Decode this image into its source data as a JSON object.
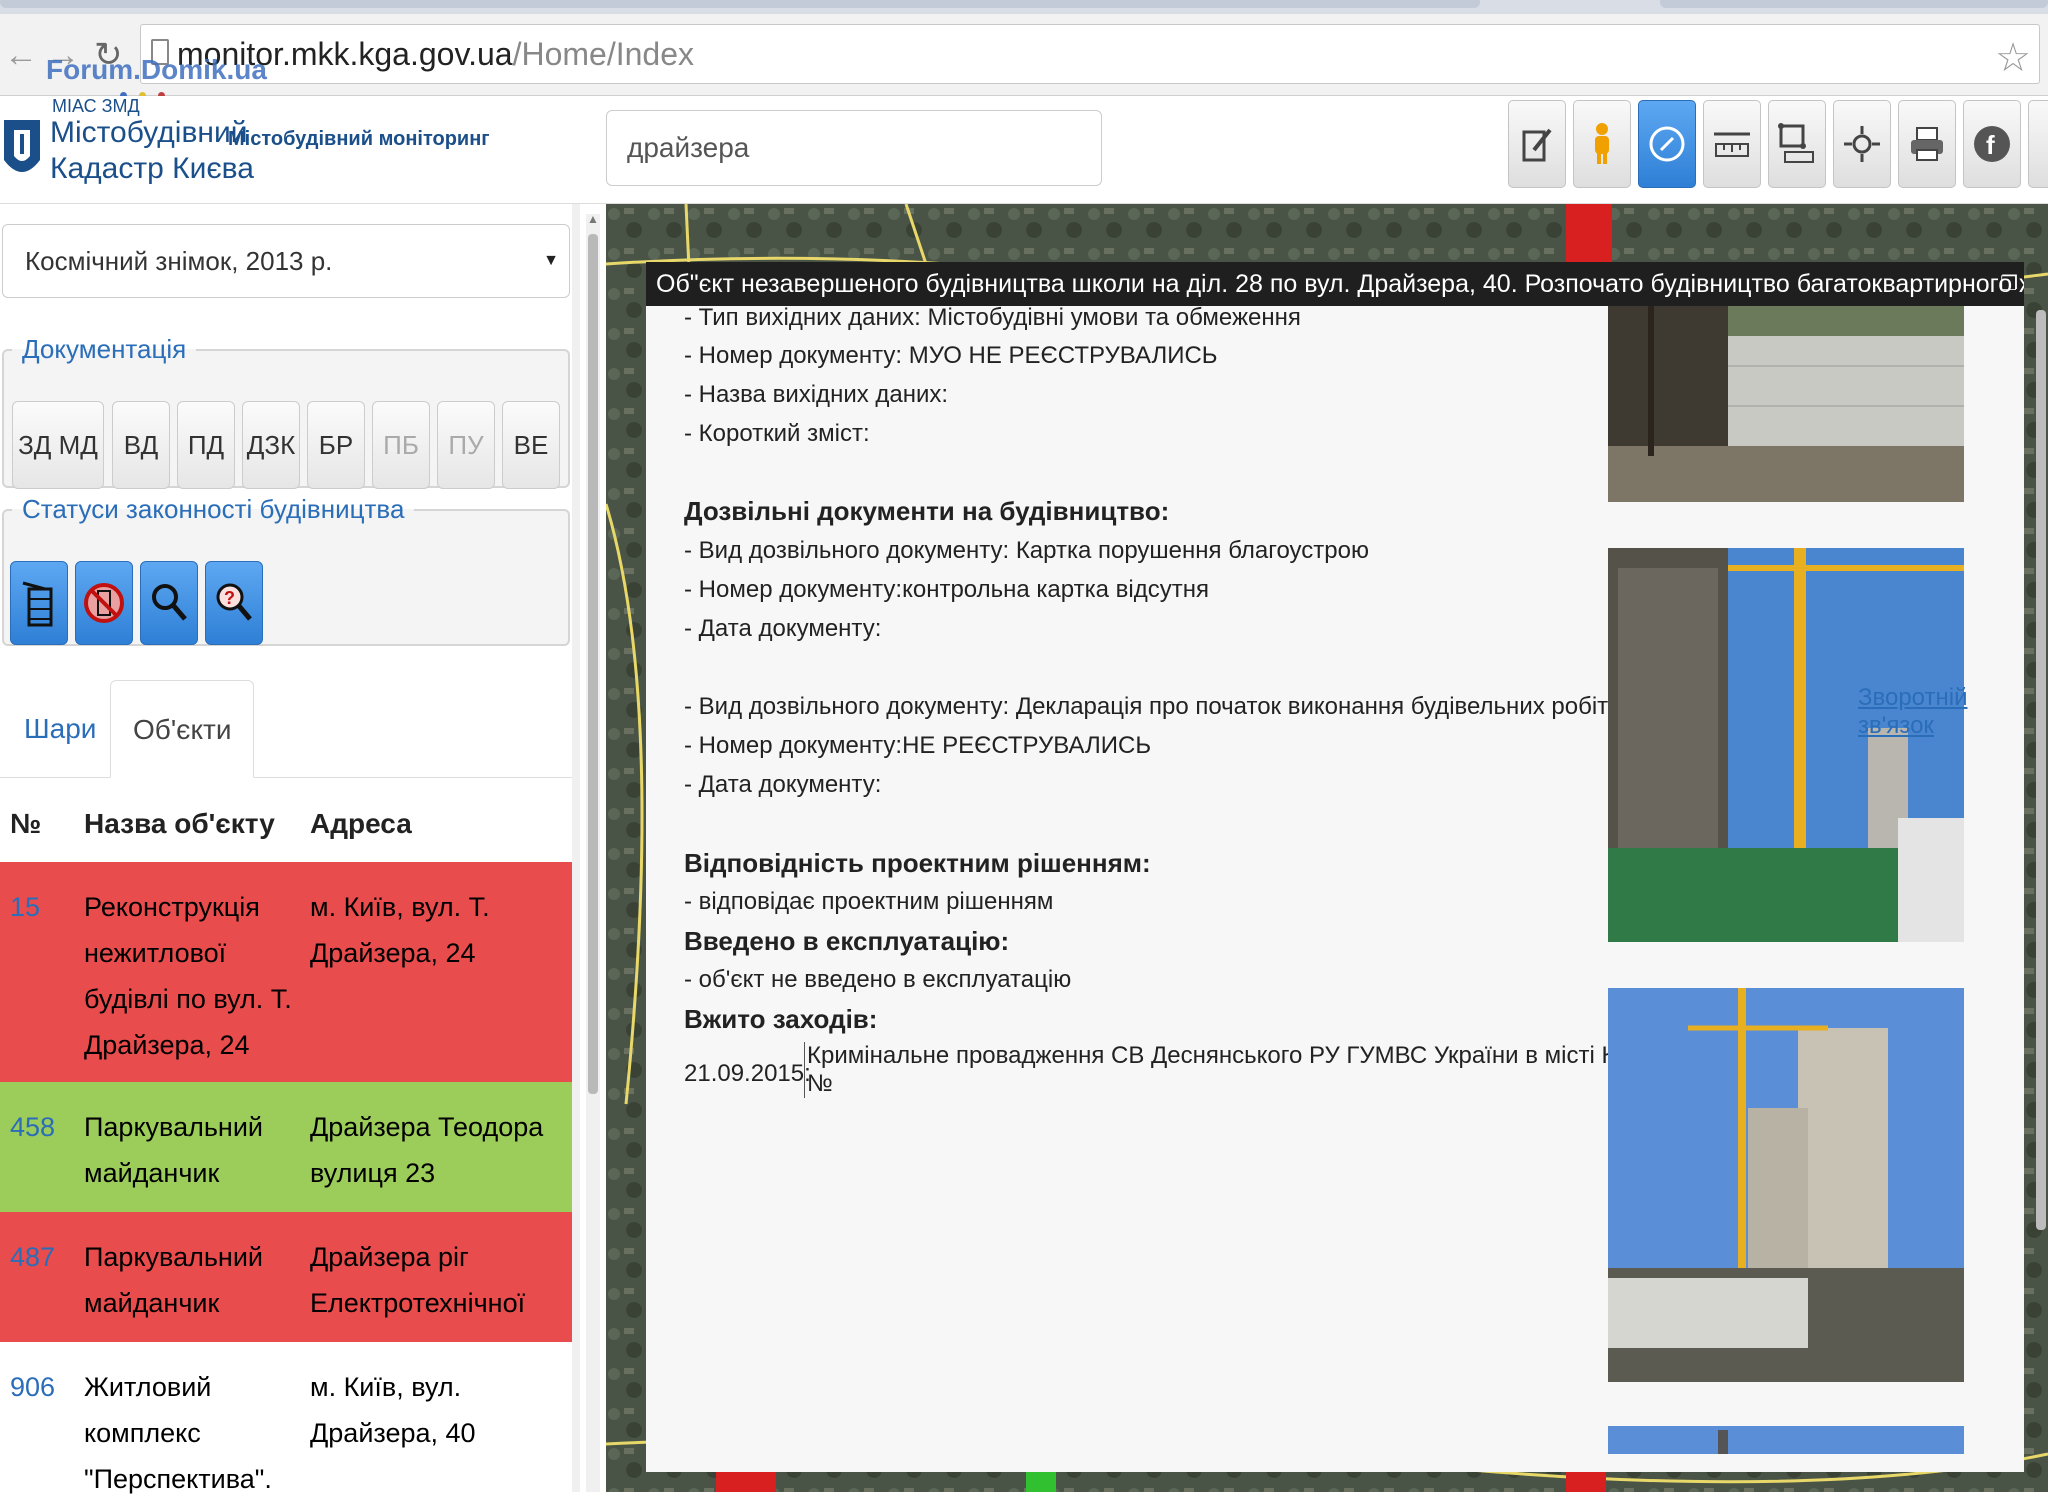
{
  "browser": {
    "url_host": "monitor.mkk.kga.gov.ua",
    "url_path": "/Home/Index",
    "watermark": "Forum.Domik.ua"
  },
  "header": {
    "logo_small": "МІАС ЗМД",
    "logo_line1": "Містобудівний",
    "logo_line2": "Кадастр Києва",
    "subtitle": "Містобудівний моніторинг",
    "search_value": "драйзера",
    "toolbar": [
      {
        "icon": "edit-icon"
      },
      {
        "icon": "person-icon"
      },
      {
        "icon": "compass-icon"
      },
      {
        "icon": "ruler-icon"
      },
      {
        "icon": "area-measure-icon"
      },
      {
        "icon": "locate-icon"
      },
      {
        "icon": "print-icon"
      },
      {
        "icon": "facebook-icon"
      }
    ]
  },
  "sidebar": {
    "layer_select": "Космічний знімок, 2013 р.",
    "documentation": {
      "legend": "Документація",
      "buttons": [
        "ЗД МД",
        "ВД",
        "ПД",
        "ДЗК",
        "БР",
        "ПБ",
        "ПУ",
        "ВЕ"
      ]
    },
    "statuses": {
      "legend": "Статуси законності будівництва",
      "buttons": [
        {
          "icon": "legal-building-icon"
        },
        {
          "icon": "illegal-building-icon"
        },
        {
          "icon": "search-icon"
        },
        {
          "icon": "unknown-status-icon"
        }
      ]
    },
    "tabs": [
      "Шари",
      "Об'єкти"
    ],
    "table": {
      "headers": [
        "№",
        "Назва об'єкту",
        "Адреса"
      ],
      "rows": [
        {
          "num": "15",
          "name": "Реконструкція нежитлової будівлі по вул. Т. Драйзера, 24",
          "addr": "м. Київ, вул. Т. Драйзера, 24",
          "color": "#e84c4c"
        },
        {
          "num": "458",
          "name": "Паркувальний майданчик",
          "addr": "Драйзера Теодора вулиця 23",
          "color": "#9ccc5a"
        },
        {
          "num": "487",
          "name": "Паркувальний майданчик",
          "addr": "Драйзера ріг Електротехнічної",
          "color": "#e84c4c"
        },
        {
          "num": "906",
          "name": "Житловий комплекс \"Перспектива\".",
          "addr": "м. Київ, вул. Драйзера, 40",
          "color": "#ffffff"
        }
      ]
    }
  },
  "popup": {
    "title": "Об\"єкт незавершеного будівництва школи на діл. 28 по вул. Драйзера, 40. Розпочато будівництво багатоквартирного житлового комплексу",
    "lines": [
      {
        "text": "- Тип вихідних даних: Містобудівні умови та обмеження",
        "bold": false
      },
      {
        "text": "- Номер документу:        МУО НЕ РЕЄСТРУВАЛИСЬ",
        "bold": false
      },
      {
        "text": "- Назва вихідних даних:",
        "bold": false
      },
      {
        "text": "- Короткий зміст:",
        "bold": false
      },
      {
        "text": "Дозвільні документи на будівництво:",
        "bold": true
      },
      {
        "text": "- Вид дозвільного документу: Картка порушення благоустрою",
        "bold": false
      },
      {
        "text": "- Номер документу:контрольна картка відсутня",
        "bold": false
      },
      {
        "text": "- Дата документу:",
        "bold": false
      },
      {
        "text": "- Вид дозвільного документу: Декларація про початок виконання будівельних робіт",
        "bold": false
      },
      {
        "text": "- Номер документу:НЕ РЕЄСТРУВАЛИСЬ",
        "bold": false
      },
      {
        "text": "- Дата документу:",
        "bold": false
      },
      {
        "text": "Відповідність проектним рішенням:",
        "bold": true
      },
      {
        "text": "- відповідає проектним рішенням",
        "bold": false
      },
      {
        "text": "Введено в експлуатацію:",
        "bold": true
      },
      {
        "text": "- об'єкт не введено в експлуатацію",
        "bold": false
      },
      {
        "text": "Вжито заходів:",
        "bold": true
      }
    ],
    "measure_date": "21.09.2015:",
    "measure_text_1": "Кримінальне провадження СВ Деснянського РУ ГУМВС України в місті Києві",
    "measure_text_2": "№",
    "feedback": "Зворотній зв'язок"
  }
}
